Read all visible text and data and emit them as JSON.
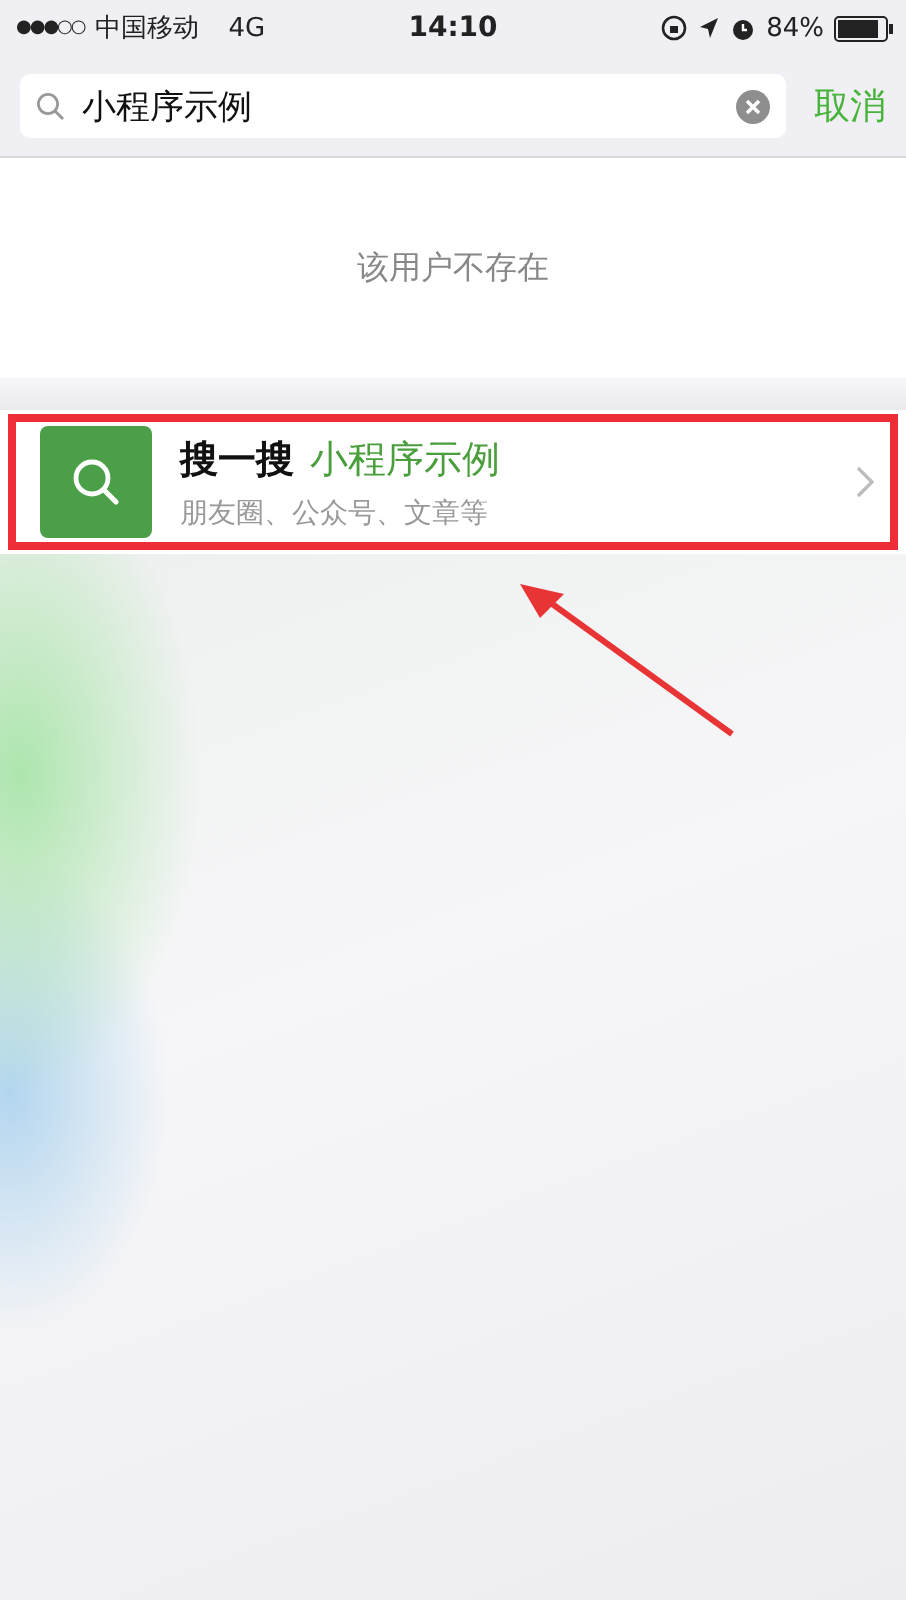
{
  "status_bar": {
    "signal": "●●●○○",
    "carrier": "中国移动",
    "network": "4G",
    "time": "14:10",
    "battery": "84%"
  },
  "search": {
    "value": "小程序示例",
    "cancel": "取消"
  },
  "message": "该用户不存在",
  "result": {
    "title_prefix": "搜一搜",
    "title_query": "小程序示例",
    "subtitle": "朋友圈、公众号、文章等"
  }
}
